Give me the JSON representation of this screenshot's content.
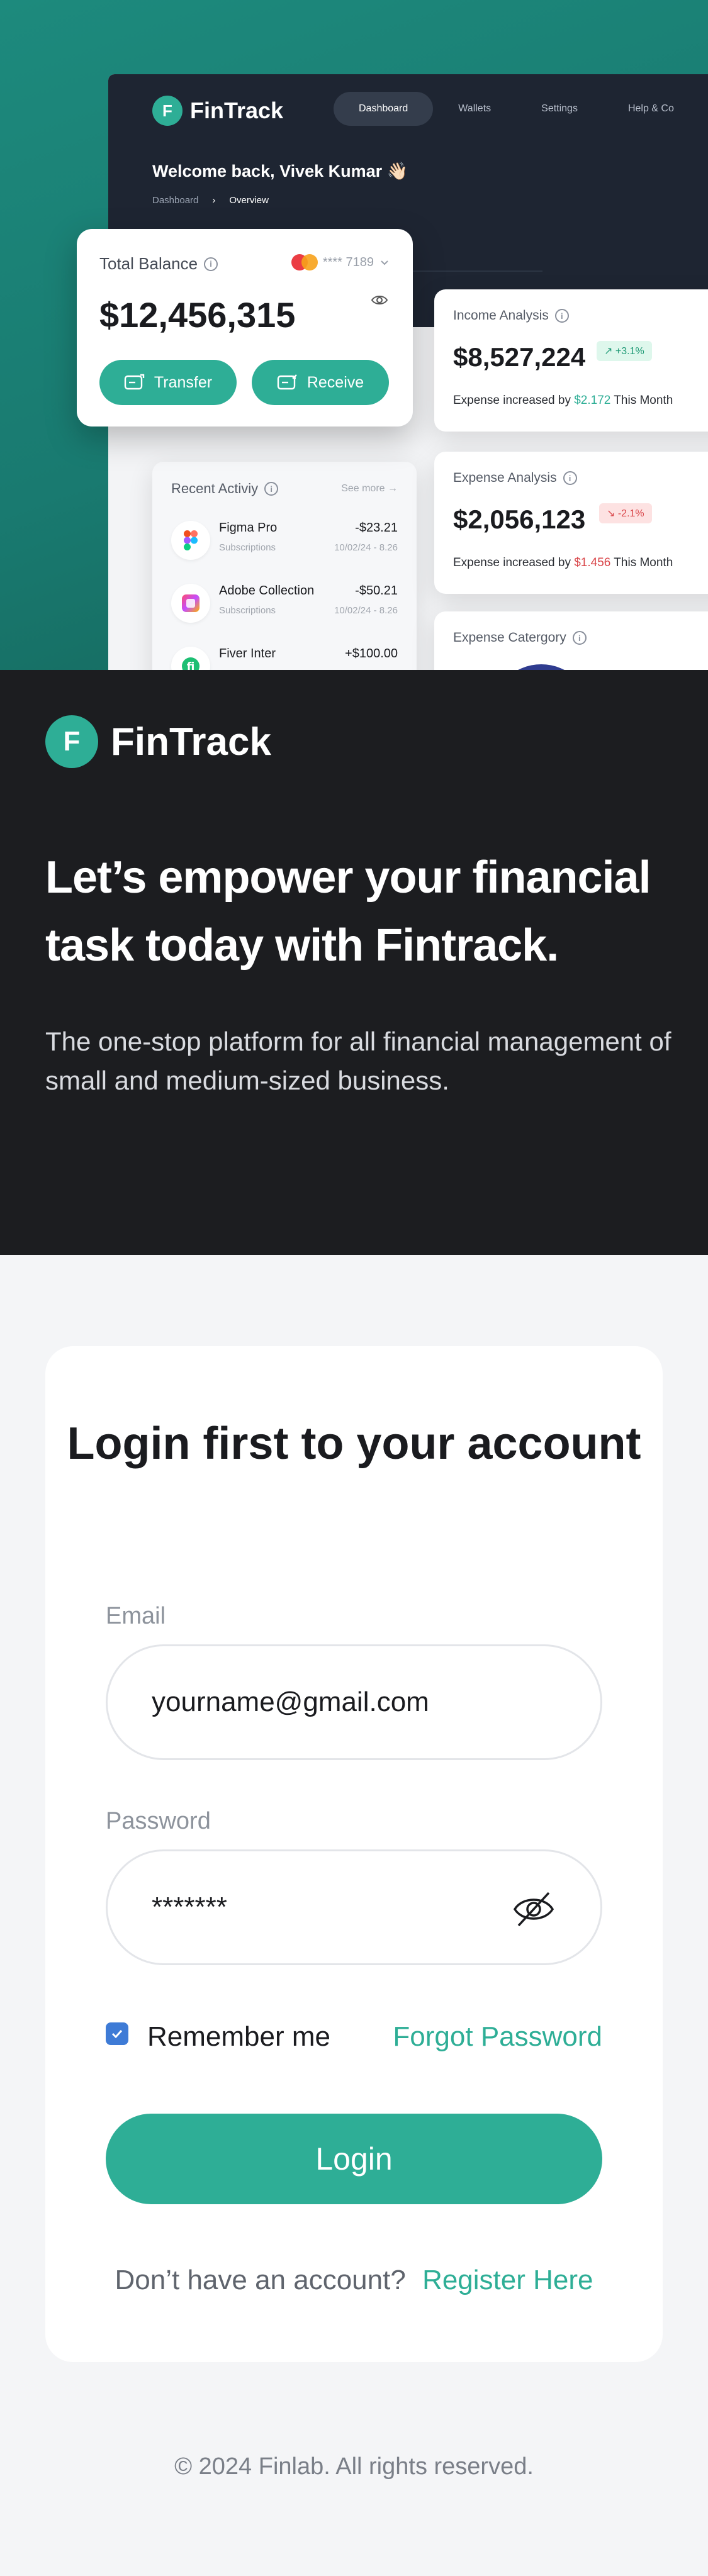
{
  "dashboard": {
    "brand": "FinTrack",
    "nav": [
      "Dashboard",
      "Wallets",
      "Settings",
      "Help & Co"
    ],
    "welcome": "Welcome back, Vivek Kumar 👋🏻",
    "breadcrumb": [
      "Dashboard",
      "Overview"
    ],
    "total_balance": {
      "label": "Total Balance",
      "account": "**** 7189",
      "amount": "$12,456,315",
      "transfer_label": "Transfer",
      "receive_label": "Receive"
    },
    "income": {
      "title": "Income Analysis",
      "amount": "$8,527,224",
      "change": "↗ +3.1%",
      "note_prefix": "Expense increased by",
      "note_value": "$2.172",
      "note_suffix": "This Month"
    },
    "expense": {
      "title": "Expense Analysis",
      "amount": "$2,056,123",
      "change": "↘ -2.1%",
      "note_prefix": "Expense increased by",
      "note_value": "$1.456",
      "note_suffix": "This Month"
    },
    "expense_category": {
      "title": "Expense Catergory"
    },
    "recent": {
      "title": "Recent Activiy",
      "see_more": "See more →",
      "items": [
        {
          "name": "Figma Pro",
          "category": "Subscriptions",
          "amount": "-$23.21",
          "date": "10/02/24 - 8.26"
        },
        {
          "name": "Adobe Collection",
          "category": "Subscriptions",
          "amount": "-$50.21",
          "date": "10/02/24 - 8.26"
        },
        {
          "name": "Fiver Inter",
          "category": "",
          "amount": "+$100.00",
          "date": ""
        }
      ]
    }
  },
  "intro": {
    "brand": "FinTrack",
    "headline": "Let’s empower your financial task today with Fintrack.",
    "description": "The one-stop platform for all financial management of small and medium-sized business."
  },
  "login": {
    "title": "Login first to your account",
    "email_label": "Email",
    "email_placeholder": "yourname@gmail.com",
    "password_label": "Password",
    "password_value": "*******",
    "remember_label": "Remember me",
    "forgot_label": "Forgot Password",
    "submit_label": "Login",
    "register_prompt": "Don’t have an account?",
    "register_link": "Register Here"
  },
  "footer": {
    "copyright": "© 2024 Finlab. All rights reserved."
  },
  "colors": {
    "accent": "#2eae96",
    "dark": "#1c1d20",
    "dash_header": "#1e2532",
    "positive": "#1f9a76",
    "negative": "#d9464a",
    "checkbox": "#3e7bd6"
  },
  "icons": [
    "info-icon",
    "mastercard-icon",
    "chevron-down-icon",
    "eye-icon",
    "transfer-icon",
    "receive-icon",
    "figma-icon",
    "adobe-icon",
    "fiverr-icon",
    "eye-off-icon",
    "check-icon"
  ]
}
